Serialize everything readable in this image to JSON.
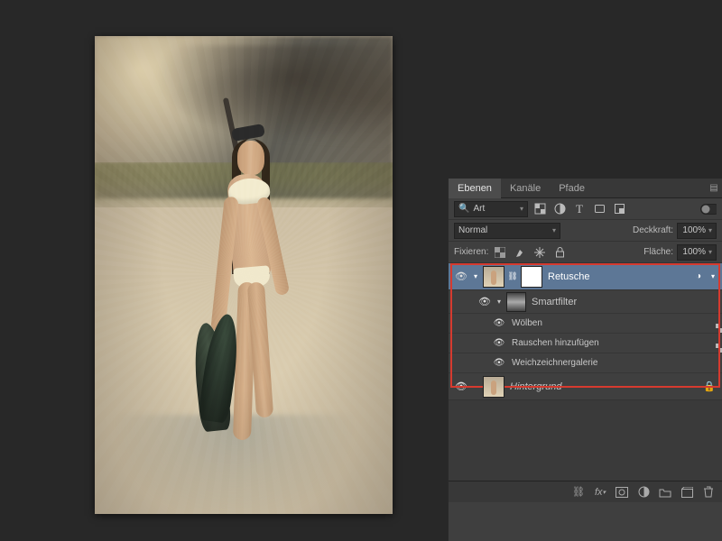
{
  "panel": {
    "tabs": [
      "Ebenen",
      "Kanäle",
      "Pfade"
    ],
    "activeTab": 0,
    "filterLabel": "Art",
    "blendMode": "Normal",
    "opacityLabel": "Deckkraft:",
    "opacityValue": "100%",
    "lockLabel": "Fixieren:",
    "fillLabel": "Fläche:",
    "fillValue": "100%"
  },
  "layers": {
    "selected": {
      "name": "Retusche",
      "smartFilters": {
        "header": "Smartfilter",
        "items": [
          "Wölben",
          "Rauschen hinzufügen",
          "Weichzeichnergalerie"
        ]
      }
    },
    "background": {
      "name": "Hintergrund"
    }
  }
}
